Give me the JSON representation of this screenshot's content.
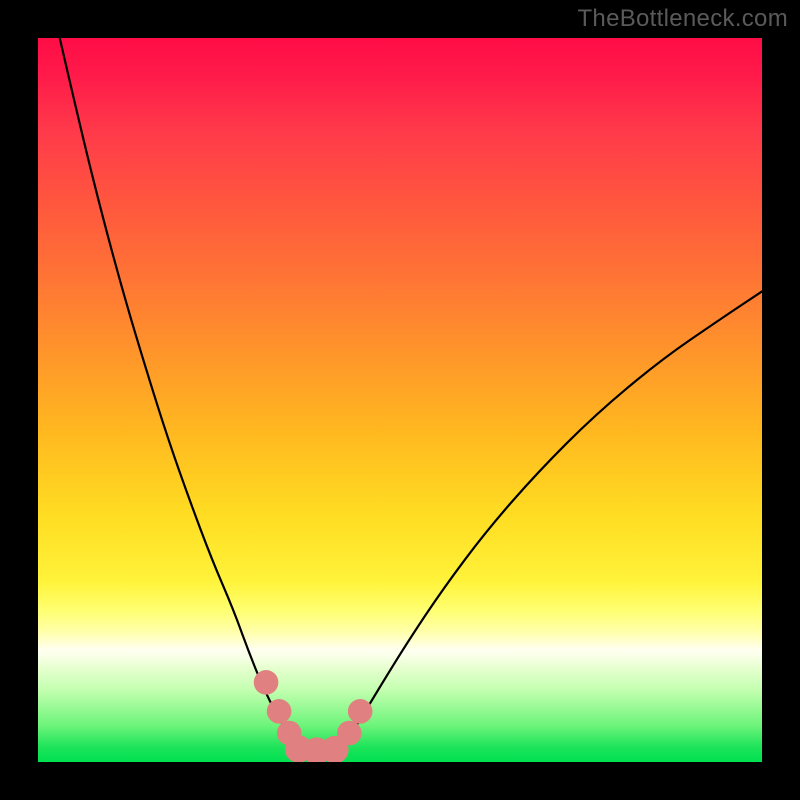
{
  "watermark": "TheBottleneck.com",
  "chart_data": {
    "type": "line",
    "title": "",
    "xlabel": "",
    "ylabel": "",
    "xlim": [
      0,
      100
    ],
    "ylim": [
      0,
      100
    ],
    "gradient_stops": [
      {
        "pct": 0,
        "color": "#ff0d46"
      },
      {
        "pct": 13,
        "color": "#ff3a4a"
      },
      {
        "pct": 35,
        "color": "#ff7a33"
      },
      {
        "pct": 55,
        "color": "#ffba1f"
      },
      {
        "pct": 75,
        "color": "#fff33a"
      },
      {
        "pct": 85,
        "color": "#fffff0"
      },
      {
        "pct": 95,
        "color": "#6cf47a"
      },
      {
        "pct": 100,
        "color": "#00e050"
      }
    ],
    "series": [
      {
        "name": "left-curve",
        "x": [
          3,
          6,
          9,
          12,
          15,
          18,
          21,
          24,
          27,
          29,
          31,
          33,
          34.5,
          36
        ],
        "y": [
          100,
          87,
          75,
          64,
          54,
          44.5,
          36,
          28,
          21,
          15.5,
          10.5,
          6.5,
          4,
          2
        ]
      },
      {
        "name": "right-curve",
        "x": [
          42,
          44,
          47,
          51,
          56,
          62,
          69,
          77,
          86,
          94,
          100
        ],
        "y": [
          2,
          5,
          10,
          16.5,
          24,
          32,
          40,
          48,
          55.5,
          61,
          65
        ]
      }
    ],
    "markers": [
      {
        "name": "left-marker-1",
        "x": 31.5,
        "y": 11,
        "r": 1.7
      },
      {
        "name": "left-marker-2",
        "x": 33.3,
        "y": 7,
        "r": 1.7
      },
      {
        "name": "left-marker-3",
        "x": 34.7,
        "y": 4,
        "r": 1.7
      },
      {
        "name": "base-marker-1",
        "x": 36,
        "y": 1.8,
        "r": 1.9
      },
      {
        "name": "base-marker-2",
        "x": 38.5,
        "y": 1.5,
        "r": 1.9
      },
      {
        "name": "base-marker-3",
        "x": 41,
        "y": 1.7,
        "r": 1.9
      },
      {
        "name": "right-marker-1",
        "x": 43,
        "y": 4,
        "r": 1.7
      },
      {
        "name": "right-marker-2",
        "x": 44.5,
        "y": 7,
        "r": 1.7
      }
    ],
    "marker_color": "#e08080",
    "curve_color": "#000000",
    "curve_width": 2.2
  }
}
